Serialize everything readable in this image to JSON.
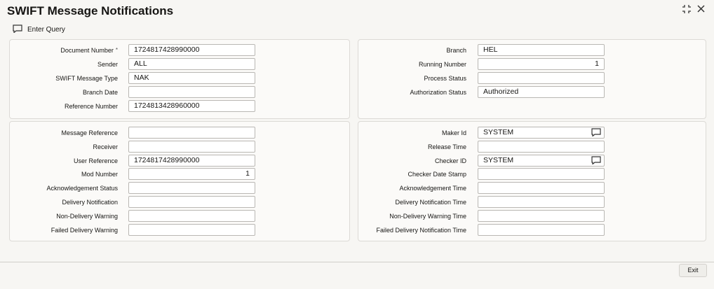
{
  "header": {
    "title": "SWIFT Message Notifications"
  },
  "toolbar": {
    "enter_query": "Enter Query"
  },
  "main": {
    "document_number": {
      "label": "Document Number",
      "required": "*",
      "value": "1724817428990000"
    },
    "sender": {
      "label": "Sender",
      "value": "ALL"
    },
    "swift_message_type": {
      "label": "SWIFT Message Type",
      "value": "NAK"
    },
    "branch_date": {
      "label": "Branch Date",
      "value": ""
    },
    "reference_number": {
      "label": "Reference Number",
      "value": "1724813428960000"
    },
    "branch": {
      "label": "Branch",
      "value": "HEL"
    },
    "running_number": {
      "label": "Running Number",
      "value": "1"
    },
    "process_status": {
      "label": "Process Status",
      "value": ""
    },
    "authorization_status": {
      "label": "Authorization Status",
      "value": "Authorized"
    }
  },
  "details": {
    "message_reference": {
      "label": "Message Reference",
      "value": ""
    },
    "receiver": {
      "label": "Receiver",
      "value": ""
    },
    "user_reference": {
      "label": "User Reference",
      "value": "1724817428990000"
    },
    "mod_number": {
      "label": "Mod Number",
      "value": "1"
    },
    "acknowledgement_status": {
      "label": "Acknowledgement Status",
      "value": ""
    },
    "delivery_notification": {
      "label": "Delivery Notification",
      "value": ""
    },
    "non_delivery_warning": {
      "label": "Non-Delivery Warning",
      "value": ""
    },
    "failed_delivery_warning": {
      "label": "Failed Delivery Warning",
      "value": ""
    },
    "maker_id": {
      "label": "Maker Id",
      "value": "SYSTEM"
    },
    "release_time": {
      "label": "Release Time",
      "value": ""
    },
    "checker_id": {
      "label": "Checker ID",
      "value": "SYSTEM"
    },
    "checker_date_stamp": {
      "label": "Checker Date Stamp",
      "value": ""
    },
    "acknowledgement_time": {
      "label": "Acknowledgement Time",
      "value": ""
    },
    "delivery_notification_time": {
      "label": "Delivery Notification Time",
      "value": ""
    },
    "non_delivery_warning_time": {
      "label": "Non-Delivery Warning Time",
      "value": ""
    },
    "failed_delivery_notification_time": {
      "label": "Failed Delivery Notification Time",
      "value": ""
    }
  },
  "footer": {
    "exit_label": "Exit"
  },
  "icons": {
    "enter_query": "chat-bubble-icon",
    "lov": "chat-bubble-icon",
    "expand": "expand-icon",
    "close": "close-icon"
  }
}
